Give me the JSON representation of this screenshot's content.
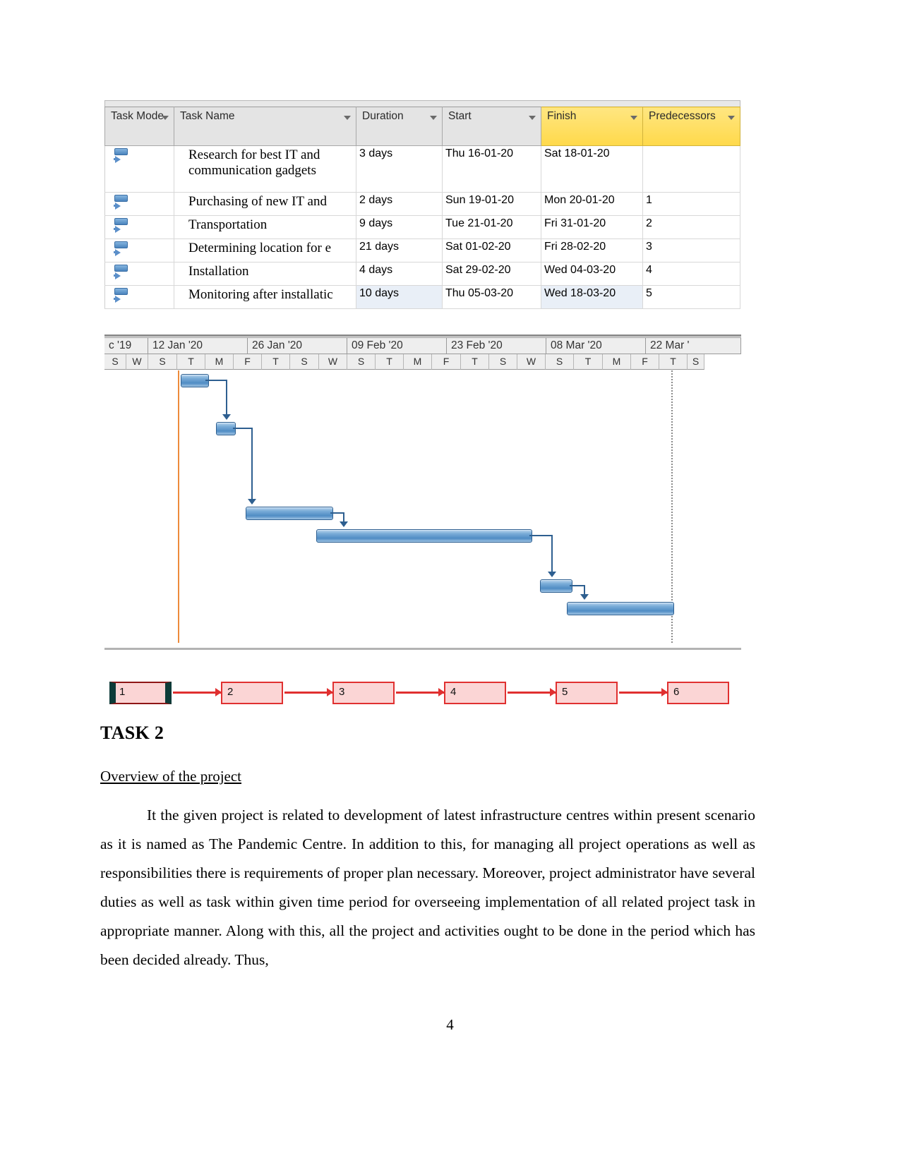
{
  "table": {
    "columns": [
      "Task Mode",
      "Task Name",
      "Duration",
      "Start",
      "Finish",
      "Predecessors"
    ],
    "highlight_column": "Finish",
    "highlight_color": "#ffd94a",
    "rows": [
      {
        "mode": "auto-scheduled",
        "name": "Research for best IT and communication gadgets",
        "duration": "3 days",
        "start": "Thu 16-01-20",
        "finish": "Sat 18-01-20",
        "predecessors": ""
      },
      {
        "mode": "auto-scheduled",
        "name": "Purchasing of new IT and",
        "duration": "2 days",
        "start": "Sun 19-01-20",
        "finish": "Mon 20-01-20",
        "predecessors": "1"
      },
      {
        "mode": "auto-scheduled",
        "name": "Transportation",
        "duration": "9 days",
        "start": "Tue 21-01-20",
        "finish": "Fri 31-01-20",
        "predecessors": "2"
      },
      {
        "mode": "auto-scheduled",
        "name": "Determining location for e",
        "duration": "21 days",
        "start": "Sat 01-02-20",
        "finish": "Fri 28-02-20",
        "predecessors": "3"
      },
      {
        "mode": "auto-scheduled",
        "name": "Installation",
        "duration": "4 days",
        "start": "Sat 29-02-20",
        "finish": "Wed 04-03-20",
        "predecessors": "4"
      },
      {
        "mode": "auto-scheduled",
        "name": "Monitoring after installatic",
        "duration": "10 days",
        "start": "Thu 05-03-20",
        "finish": "Wed 18-03-20",
        "predecessors": "5"
      }
    ]
  },
  "gantt": {
    "timescale_major": [
      "c '19",
      "12 Jan '20",
      "26 Jan '20",
      "09 Feb '20",
      "23 Feb '20",
      "08 Mar '20",
      "22 Mar '"
    ],
    "timescale_minor": [
      "S",
      "W",
      "S",
      "T",
      "M",
      "F",
      "T",
      "S",
      "W",
      "S",
      "T",
      "M",
      "F",
      "T",
      "S",
      "W",
      "S",
      "T",
      "M",
      "F",
      "T",
      "S"
    ],
    "today_line_color": "#ed8b3b",
    "bar_color": "#4f8cc4",
    "bars": [
      {
        "task": "Research for best IT and communication gadgets",
        "start_pct": 12.0,
        "width_pct": 4.2,
        "row": 0
      },
      {
        "task": "Purchasing of new IT and",
        "start_pct": 15.6,
        "width_pct": 2.9,
        "row": 1
      },
      {
        "task": "Transportation",
        "start_pct": 20.3,
        "width_pct": 13.0,
        "row": 2
      },
      {
        "task": "Determining location for e",
        "start_pct": 33.2,
        "width_pct": 33.4,
        "row": 3
      },
      {
        "task": "Installation",
        "start_pct": 68.5,
        "width_pct": 5.0,
        "row": 4
      },
      {
        "task": "Monitoring after installatic",
        "start_pct": 72.8,
        "width_pct": 16.8,
        "row": 5
      }
    ]
  },
  "network_diagram": {
    "nodes": [
      "1",
      "2",
      "3",
      "4",
      "5",
      "6"
    ],
    "critical_node": "1",
    "node_fill": "#fbd5d5",
    "node_border": "#e03030",
    "arrow_color": "#e03030"
  },
  "document": {
    "task_title": "TASK 2",
    "subheading": "Overview of the project ",
    "paragraph": "It the given project is related to development of latest infrastructure centres within present scenario as it is named as The Pandemic Centre. In addition to this, for managing all project operations as well as responsibilities there is requirements of proper plan necessary. Moreover, project administrator have several duties as well as task within given time period for overseeing implementation of all related project task in appropriate manner. Along with this, all the project and activities ought to be done in the period which has been decided already. Thus,",
    "page_number": "4"
  }
}
